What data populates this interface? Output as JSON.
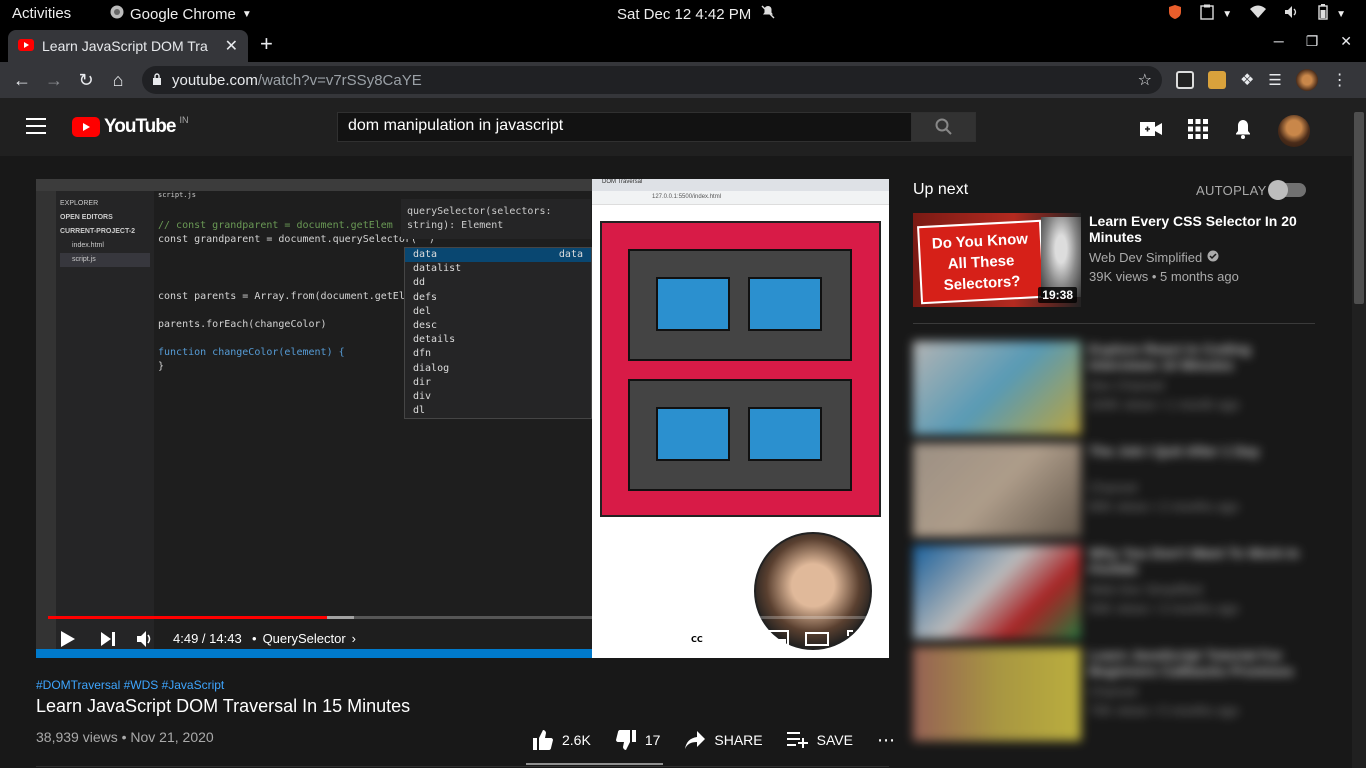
{
  "gnome": {
    "activities": "Activities",
    "app_name": "Google Chrome",
    "clock": "Sat Dec 12  4:42 PM"
  },
  "chrome": {
    "tab_title": "Learn JavaScript DOM Tra",
    "url_host": "youtube.com",
    "url_path": "/watch?v=v7rSSy8CaYE"
  },
  "youtube": {
    "logo_text": "YouTube",
    "country": "IN",
    "search_value": "dom manipulation in javascript"
  },
  "player": {
    "progress_fraction": 0.337,
    "time_display": "4:49 / 14:43",
    "chapter": "QuerySelector",
    "code": {
      "file_tab": "script.js",
      "explorer_header": "EXPLORER",
      "open_editors": "OPEN EDITORS",
      "project": "CURRENT-PROJECT-2",
      "files": [
        "index.html",
        "script.js"
      ],
      "lines": [
        "// const grandparent = document.getElem",
        "const grandparent = document.querySelector(\"\")",
        "const parents = Array.from(document.getEle",
        "parents.forEach(changeColor)",
        "function changeColor(element) {",
        "}"
      ],
      "hint_sig": "querySelector(selectors:",
      "hint_ret": "string): Element",
      "suggestions": [
        "data",
        "datalist",
        "dd",
        "defs",
        "del",
        "desc",
        "details",
        "dfn",
        "dialog",
        "dir",
        "div",
        "dl"
      ],
      "suggestion_detail": "data"
    },
    "browser_tab": "DOM Traversal",
    "browser_url": "127.0.0.1:5500/index.html"
  },
  "video": {
    "hashtags": "#DOMTraversal #WDS #JavaScript",
    "title": "Learn JavaScript DOM Traversal In 15 Minutes",
    "meta": "38,939 views • Nov 21, 2020",
    "likes": "2.6K",
    "dislikes": "17",
    "share_label": "SHARE",
    "save_label": "SAVE"
  },
  "sidebar": {
    "up_next": "Up next",
    "autoplay": "AUTOPLAY",
    "autoplay_on": false,
    "first": {
      "title": "Learn Every CSS Selector In 20 Minutes",
      "channel": "Web Dev Simplified",
      "views": "39K views • 5 months ago",
      "duration": "19:38",
      "thumb_text": "Do You Know All These Selectors?"
    },
    "blurred": [
      {
        "title": "Explore React in Coding Interviews 10 Minutes",
        "channel": "Dev Channel",
        "views": "100K views • 1 month ago"
      },
      {
        "title": "The Job I Quit After 1 Day",
        "channel": "Channel",
        "views": "80K views • 2 months ago"
      },
      {
        "title": "Why You Don't Want To Work In FAANG",
        "channel": "Web Dev Simplified",
        "views": "50K views • 3 months ago"
      },
      {
        "title": "Learn JavaScript Tutorial For Beginners Callbacks Promises",
        "channel": "Channel",
        "views": "70K views • 5 months ago"
      }
    ]
  }
}
